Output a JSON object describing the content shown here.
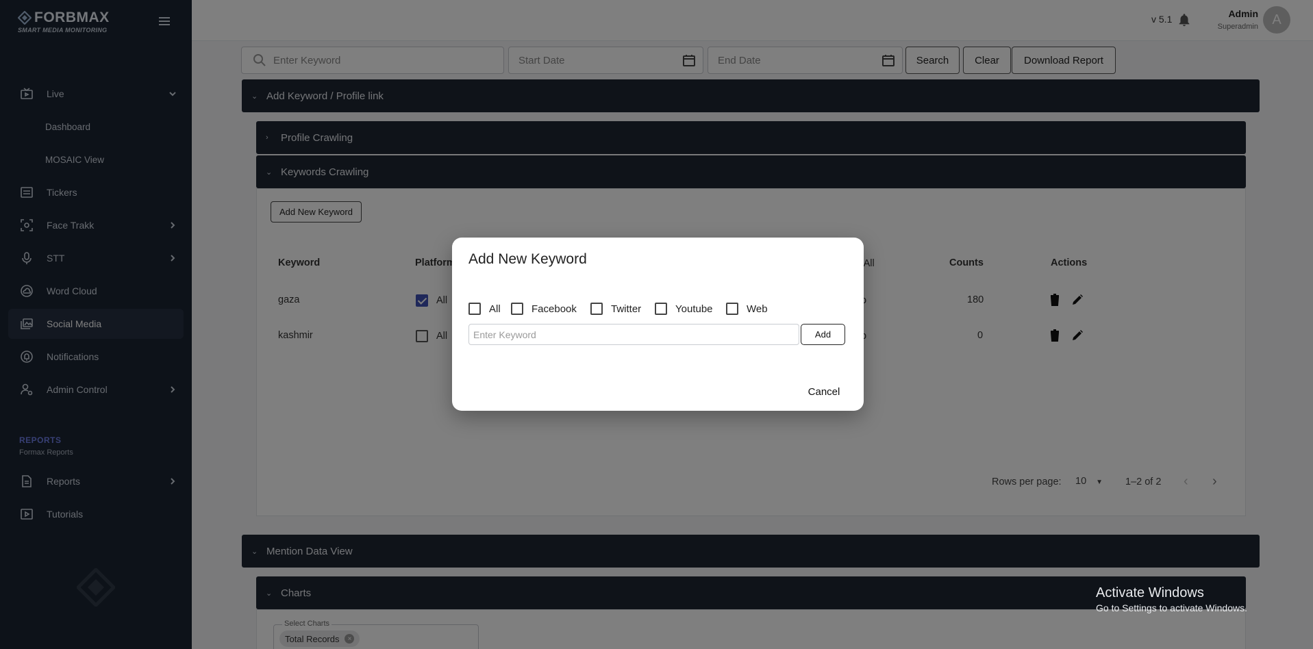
{
  "brand": {
    "name": "FORBMAX",
    "tagline": "SMART MEDIA MONITORING"
  },
  "sidebar": {
    "items": [
      {
        "label": "Live",
        "icon": "live-tv-icon",
        "expanded": true
      },
      {
        "label": "Dashboard"
      },
      {
        "label": "MOSAIC View"
      },
      {
        "label": "Tickers",
        "icon": "tickers-icon"
      },
      {
        "label": "Face Trakk",
        "icon": "face-scan-icon"
      },
      {
        "label": "STT",
        "icon": "microphone-icon"
      },
      {
        "label": "Word Cloud",
        "icon": "cloud-icon"
      },
      {
        "label": "Social Media",
        "icon": "image-gallery-icon",
        "active": true
      },
      {
        "label": "Notifications",
        "icon": "notification-icon"
      },
      {
        "label": "Admin Control",
        "icon": "admin-user-icon"
      }
    ],
    "reports_section": {
      "title": "REPORTS",
      "subtitle": "Formax Reports"
    },
    "items2": [
      {
        "label": "Reports",
        "icon": "report-document-icon"
      },
      {
        "label": "Tutorials",
        "icon": "tutorial-video-icon"
      }
    ]
  },
  "topbar": {
    "version": "v 5.1",
    "user_name": "Admin",
    "user_role": "Superadmin",
    "avatar_letter": "A"
  },
  "filters": {
    "keyword_placeholder": "Enter Keyword",
    "start_date_placeholder": "Start Date",
    "end_date_placeholder": "End Date",
    "search_label": "Search",
    "clear_label": "Clear",
    "download_label": "Download Report"
  },
  "panels": {
    "add_keyword": "Add Keyword / Profile link",
    "profile_crawling": "Profile Crawling",
    "keywords_crawling": "Keywords Crawling",
    "mention_data_view": "Mention Data View",
    "charts": "Charts"
  },
  "keywords": {
    "add_new_label": "Add New Keyword",
    "columns": {
      "keyword": "Keyword",
      "platform": "Platform",
      "select_all": "ect All",
      "counts": "Counts",
      "actions": "Actions"
    },
    "rows": [
      {
        "keyword": "gaza",
        "platform_all": "All",
        "checked": true,
        "select_tail": "o",
        "count": "180"
      },
      {
        "keyword": "kashmir",
        "platform_all": "All",
        "checked": false,
        "select_tail": "o",
        "count": "0"
      }
    ],
    "pagination": {
      "rows_per_page_label": "Rows per page:",
      "rows_per_page_value": "10",
      "range": "1–2 of 2"
    }
  },
  "charts_section": {
    "select_label": "Select Charts",
    "chip": "Total Records"
  },
  "modal": {
    "title": "Add New Keyword",
    "options": [
      "All",
      "Facebook",
      "Twitter",
      "Youtube",
      "Web"
    ],
    "keyword_placeholder": "Enter Keyword",
    "add_label": "Add",
    "cancel_label": "Cancel"
  },
  "os_watermark": {
    "line1": "Activate Windows",
    "line2": "Go to Settings to activate Windows."
  }
}
